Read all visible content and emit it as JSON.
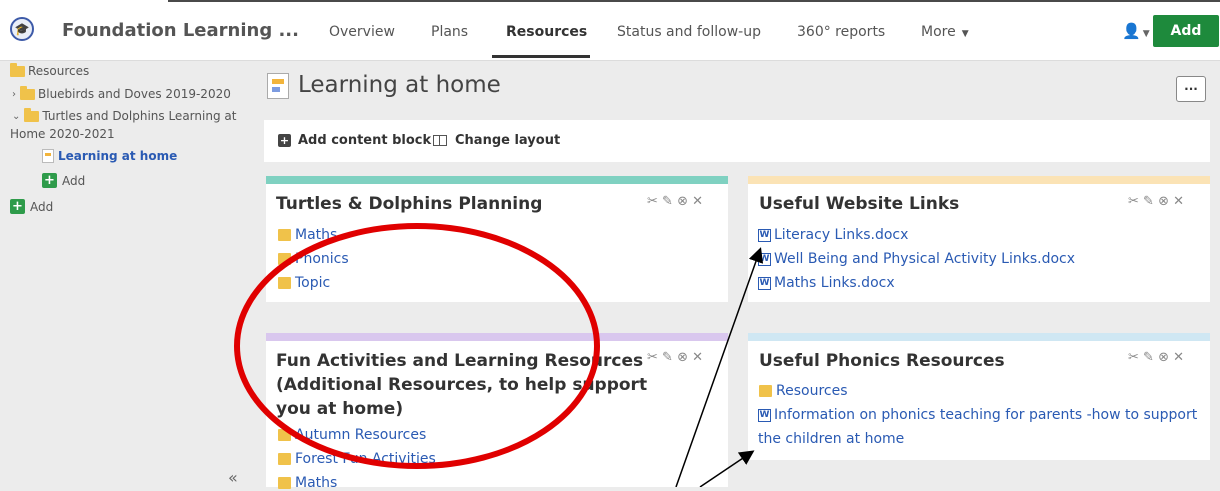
{
  "header": {
    "app_title": "Foundation Learning ...",
    "tabs": [
      {
        "label": "Overview"
      },
      {
        "label": "Plans"
      },
      {
        "label": "Resources"
      },
      {
        "label": "Status and follow-up"
      },
      {
        "label": "360° reports"
      },
      {
        "label": "More"
      }
    ],
    "add_label": "Add"
  },
  "sidebar": {
    "root": "Resources",
    "items": [
      {
        "label": "Bluebirds and Doves 2019-2020"
      },
      {
        "label_line1": "Turtles and Dolphins Learning at",
        "label_line2": "Home 2020-2021"
      },
      {
        "label": "Learning at home"
      },
      {
        "label": "Add"
      },
      {
        "label": "Add"
      }
    ],
    "collapse_glyph": "«"
  },
  "page": {
    "title": "Learning at home",
    "more_glyph": "···"
  },
  "toolbar": {
    "add_block": "Add content block",
    "change_layout": "Change layout"
  },
  "cards": {
    "planning": {
      "title": "Turtles & Dolphins Planning",
      "accent": "#7fd1c1",
      "links": [
        "Maths",
        "Phonics",
        "Topic"
      ]
    },
    "websites": {
      "title": "Useful Website Links",
      "accent": "#fbe3b5",
      "links": [
        "Literacy Links.docx",
        "Well Being and Physical Activity Links.docx",
        "Maths Links.docx"
      ]
    },
    "fun": {
      "title_line1": "Fun Activities and Learning Resources",
      "title_line2": "(Additional Resources, to help support",
      "title_line3": "you at home)",
      "accent": "#d9c7ee",
      "links": [
        "Autumn Resources",
        "Forest Fun Activities",
        "Maths"
      ]
    },
    "phonics": {
      "title": "Useful Phonics Resources",
      "accent": "#cfe7f3",
      "links": [
        "Resources"
      ],
      "doc_line1": "Information on phonics teaching for parents -how to support",
      "doc_line2": "the children at home"
    }
  },
  "colors": {
    "add_green": "#1e8a3c",
    "annotation_red": "#e00000",
    "link_blue": "#2a5ab3"
  }
}
